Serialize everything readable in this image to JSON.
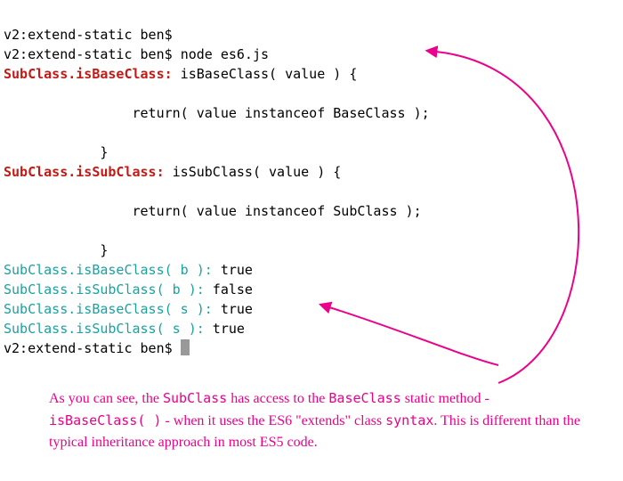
{
  "terminal": {
    "prompt": "v2:extend-static ben$",
    "command": "node es6.js",
    "out1_label": "SubClass.isBaseClass:",
    "out1_rest": " isBaseClass( value ) {",
    "out1_body": "                return( value instanceof BaseClass );",
    "out1_close": "            }",
    "out2_label": "SubClass.isSubClass:",
    "out2_rest": " isSubClass( value ) {",
    "out2_body": "                return( value instanceof SubClass );",
    "out2_close": "            }",
    "r1_call": "SubClass.isBaseClass( b ):",
    "r1_val": " true",
    "r2_call": "SubClass.isSubClass( b ):",
    "r2_val": " false",
    "r3_call": "SubClass.isBaseClass( s ):",
    "r3_val": " true",
    "r4_call": "SubClass.isSubClass( s ):",
    "r4_val": " true"
  },
  "annotation": {
    "t1": "As you can see, the ",
    "m1": "SubClass",
    "t2": " has access to the ",
    "m2": "BaseClass",
    "t3": " static method - ",
    "m3": "isBaseClass( )",
    "t4": "  - when it uses the ES6 \"extends\" class ",
    "m4": "syntax",
    "t5": ". This is different than the typical inheritance approach in most ES5 code."
  }
}
